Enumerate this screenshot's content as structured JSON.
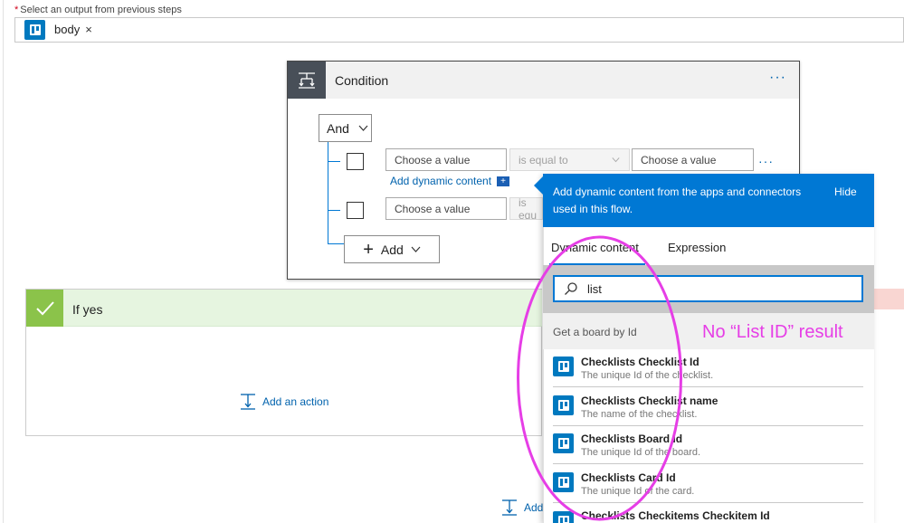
{
  "top": {
    "required_mark": "*",
    "select_label": "Select an output from previous steps",
    "token_label": "body",
    "token_remove": "×"
  },
  "condition": {
    "title": "Condition",
    "menu": "···",
    "and_label": "And",
    "rows": [
      {
        "value_placeholder": "Choose a value",
        "operator": "is equal to",
        "value2_placeholder": "Choose a value",
        "row_menu": "···"
      },
      {
        "value_placeholder": "Choose a value",
        "operator": "is equ"
      }
    ],
    "dynamic_link": "Add dynamic content",
    "dynamic_plus": "+",
    "add_label": "Add"
  },
  "if_yes": {
    "title": "If yes",
    "add_action": "Add an action"
  },
  "bottom": {
    "add_label": "Add"
  },
  "flyout": {
    "description": "Add dynamic content from the apps and connectors used in this flow.",
    "hide_label": "Hide",
    "tabs": [
      "Dynamic content",
      "Expression"
    ],
    "search_value": "list",
    "section_title": "Get a board by Id",
    "items": [
      {
        "name": "Checklists Checklist Id",
        "desc": "The unique Id of the checklist."
      },
      {
        "name": "Checklists Checklist name",
        "desc": "The name of the checklist."
      },
      {
        "name": "Checklists Board Id",
        "desc": "The unique Id of the board."
      },
      {
        "name": "Checklists Card Id",
        "desc": "The unique Id of the card."
      },
      {
        "name": "Checklists Checkitems Checkitem Id",
        "desc": ""
      }
    ]
  },
  "annotation": {
    "text": "No “List ID” result",
    "color": "#e63ee6"
  },
  "colors": {
    "accent": "#0078d4",
    "trello": "#0079bf",
    "yes_green": "#8bc34a",
    "condition_dark": "#484f58"
  }
}
